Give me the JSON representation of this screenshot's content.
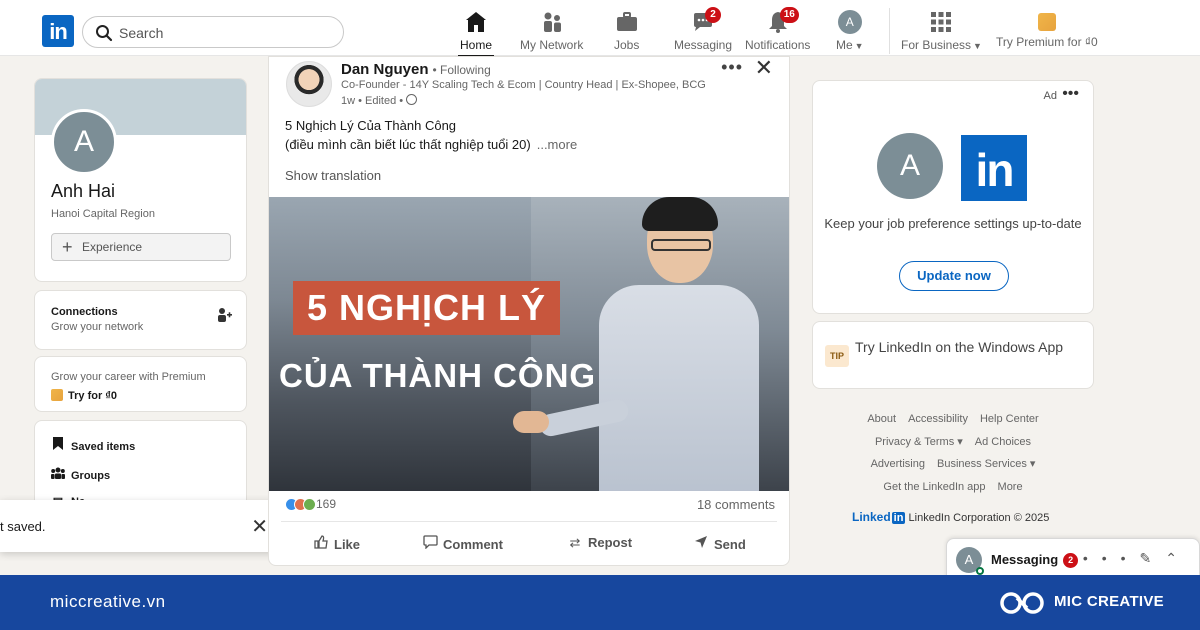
{
  "nav": {
    "search_placeholder": "Search",
    "items": [
      {
        "label": "Home"
      },
      {
        "label": "My Network"
      },
      {
        "label": "Jobs"
      },
      {
        "label": "Messaging",
        "badge": "2"
      },
      {
        "label": "Notifications",
        "badge": "16"
      },
      {
        "label": "Me",
        "avatar": "A"
      },
      {
        "label": "For Business"
      },
      {
        "label": "Try Premium for ₫0"
      }
    ]
  },
  "profile": {
    "initial": "A",
    "name": "Anh Hai",
    "location": "Hanoi Capital Region",
    "experience_label": "Experience"
  },
  "connections": {
    "title": "Connections",
    "subtitle": "Grow your network"
  },
  "premium": {
    "subtitle": "Grow your career with Premium",
    "cta": "Try for ₫0"
  },
  "saved_list": [
    {
      "label": "Saved items"
    },
    {
      "label": "Groups"
    },
    {
      "label": "Ne..."
    }
  ],
  "toast": {
    "text": "t saved."
  },
  "post": {
    "author": "Dan Nguyen",
    "following": "• Following",
    "headline": "Co-Founder - 14Y Scaling Tech & Ecom | Country Head | Ex-Shopee, BCG",
    "time": "1w • Edited •",
    "text_line1": "5 Nghịch Lý Của Thành Công",
    "text_line2": "(điều mình cần biết lúc thất nghiệp tuổi 20)",
    "more": "...more",
    "show_translation": "Show translation",
    "image_title1": "5 NGHỊCH LÝ",
    "image_title2": "CỦA THÀNH CÔNG",
    "reactions": "169",
    "comments": "18 comments",
    "actions": [
      {
        "label": "Like"
      },
      {
        "label": "Comment"
      },
      {
        "label": "Repost"
      },
      {
        "label": "Send"
      }
    ]
  },
  "ad": {
    "label": "Ad",
    "initial": "A",
    "logo_text": "in",
    "text": "Keep your job preference settings up-to-date",
    "button": "Update now"
  },
  "tip": {
    "badge": "TIP",
    "text": "Try LinkedIn on the Windows App"
  },
  "footer": {
    "row1": [
      "About",
      "Accessibility",
      "Help Center"
    ],
    "row2": [
      "Privacy & Terms ▾",
      "Ad Choices"
    ],
    "row3": [
      "Advertising",
      "Business Services ▾"
    ],
    "row4": [
      "Get the LinkedIn app",
      "More"
    ],
    "brand": "Linked",
    "brand_in": "in",
    "corp": "LinkedIn Corporation © 2025"
  },
  "messaging": {
    "initial": "A",
    "title": "Messaging",
    "badge": "2"
  },
  "brand_band": {
    "url": "miccreative.vn",
    "name": "MIC CREATIVE"
  },
  "colors": {
    "linkedin_blue": "#0a66c2",
    "band_blue": "#17479e",
    "badge_red": "#cc1016"
  }
}
